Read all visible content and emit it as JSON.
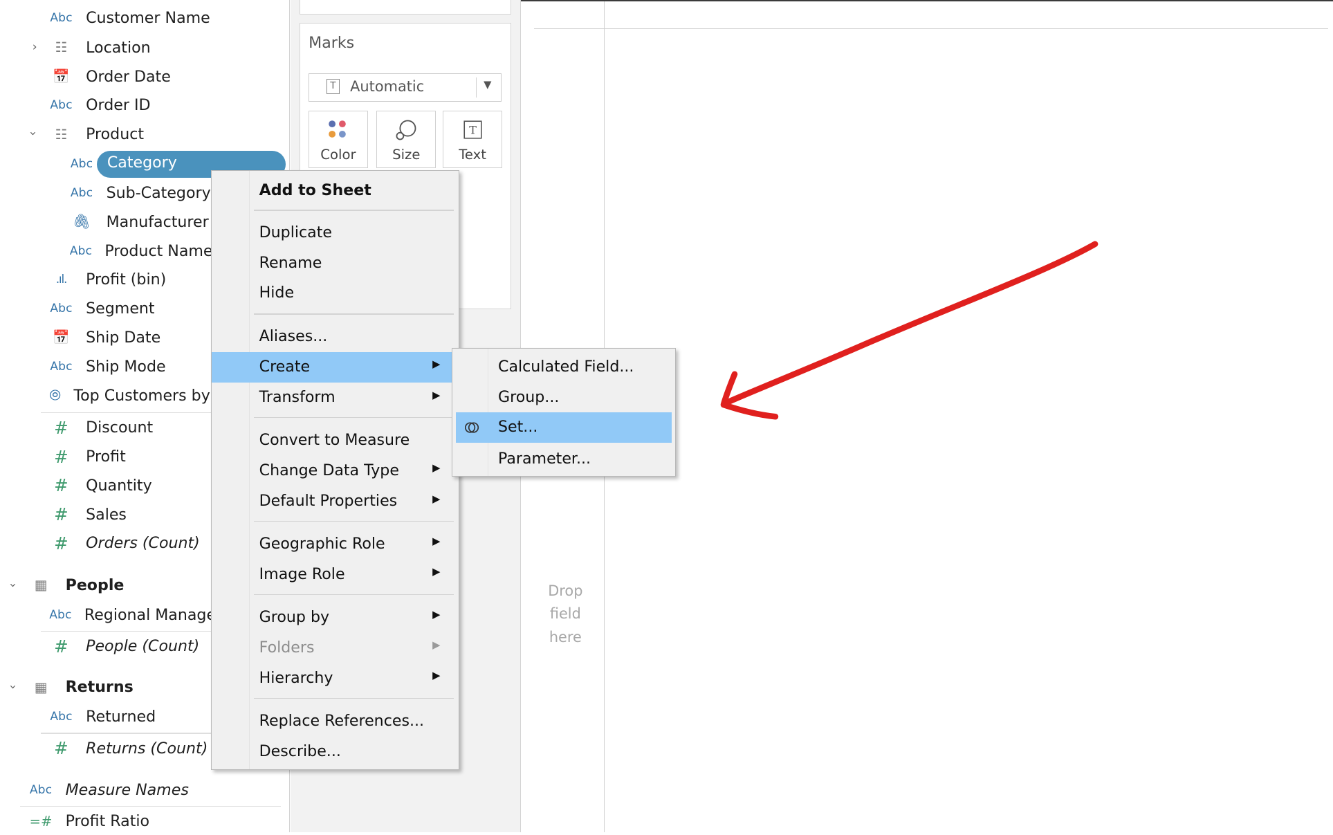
{
  "data_pane": {
    "fields": [
      {
        "icon": "Abc",
        "label": "Customer Name"
      },
      {
        "icon": "hierarchy",
        "label": "Location"
      },
      {
        "icon": "calendar",
        "label": "Order Date"
      },
      {
        "icon": "Abc",
        "label": "Order ID"
      },
      {
        "icon": "hierarchy",
        "label": "Product"
      },
      {
        "icon": "Abc",
        "label": "Category"
      },
      {
        "icon": "Abc",
        "label": "Sub-Category"
      },
      {
        "icon": "paperclip",
        "label": "Manufacturer"
      },
      {
        "icon": "Abc",
        "label": "Product Name"
      },
      {
        "icon": "bin",
        "label": "Profit (bin)"
      },
      {
        "icon": "Abc",
        "label": "Segment"
      },
      {
        "icon": "calendar",
        "label": "Ship Date"
      },
      {
        "icon": "Abc",
        "label": "Ship Mode"
      },
      {
        "icon": "set",
        "label": "Top Customers by Profit"
      },
      {
        "icon": "#",
        "label": "Discount"
      },
      {
        "icon": "#",
        "label": "Profit"
      },
      {
        "icon": "#",
        "label": "Quantity"
      },
      {
        "icon": "#",
        "label": "Sales"
      },
      {
        "icon": "#",
        "label": "Orders (Count)"
      },
      {
        "icon": "table",
        "label": "People"
      },
      {
        "icon": "Abc",
        "label": "Regional Manager"
      },
      {
        "icon": "#",
        "label": "People (Count)"
      },
      {
        "icon": "table",
        "label": "Returns"
      },
      {
        "icon": "Abc",
        "label": "Returned"
      },
      {
        "icon": "#",
        "label": "Returns (Count)"
      },
      {
        "icon": "Abc",
        "label": "Measure Names"
      },
      {
        "icon": "=#",
        "label": "Profit Ratio"
      }
    ],
    "selected_field": "Category"
  },
  "marks": {
    "title": "Marks",
    "mark_type": "Automatic",
    "buttons": [
      "Color",
      "Size",
      "Text"
    ]
  },
  "view": {
    "drop_hint": [
      "Drop",
      "field",
      "here"
    ]
  },
  "context_menu": {
    "items": [
      {
        "label": "Add to Sheet",
        "bold": true
      },
      {
        "label": "Duplicate"
      },
      {
        "label": "Rename"
      },
      {
        "label": "Hide"
      },
      {
        "label": "Aliases..."
      },
      {
        "label": "Create",
        "submenu": true,
        "highlighted": true
      },
      {
        "label": "Transform",
        "submenu": true
      },
      {
        "label": "Convert to Measure"
      },
      {
        "label": "Change Data Type",
        "submenu": true
      },
      {
        "label": "Default Properties",
        "submenu": true
      },
      {
        "label": "Geographic Role",
        "submenu": true
      },
      {
        "label": "Image Role",
        "submenu": true
      },
      {
        "label": "Group by",
        "submenu": true
      },
      {
        "label": "Folders",
        "submenu": true,
        "disabled": true
      },
      {
        "label": "Hierarchy",
        "submenu": true
      },
      {
        "label": "Replace References..."
      },
      {
        "label": "Describe..."
      }
    ]
  },
  "create_submenu": {
    "items": [
      {
        "label": "Calculated Field..."
      },
      {
        "label": "Group..."
      },
      {
        "label": "Set...",
        "highlighted": true
      },
      {
        "label": "Parameter..."
      }
    ]
  },
  "colors": {
    "selected_pill": "#4a92bd",
    "menu_highlight": "#91c9f7",
    "measure_icon": "#3f9a6d",
    "dimension_icon": "#3675a9",
    "annotation_arrow": "#e0201e"
  }
}
